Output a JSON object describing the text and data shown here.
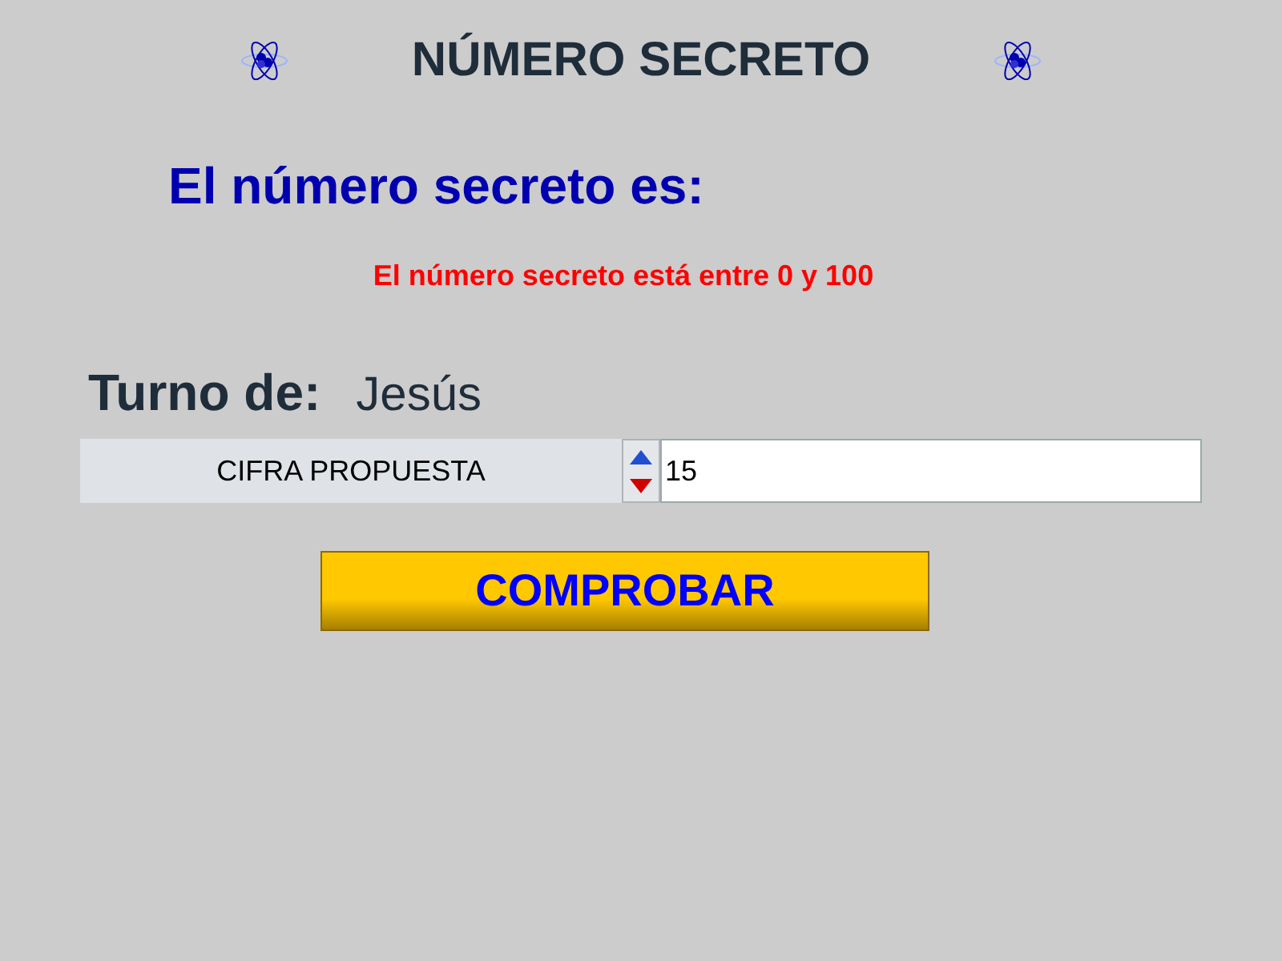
{
  "title": "NÚMERO SECRETO",
  "secret_heading": "El número secreto es:",
  "hint": "El número secreto está entre 0 y 100",
  "turn": {
    "label": "Turno de:",
    "player": "Jesús"
  },
  "guess": {
    "label": "CIFRA PROPUESTA",
    "value": "15"
  },
  "button": "COMPROBAR"
}
